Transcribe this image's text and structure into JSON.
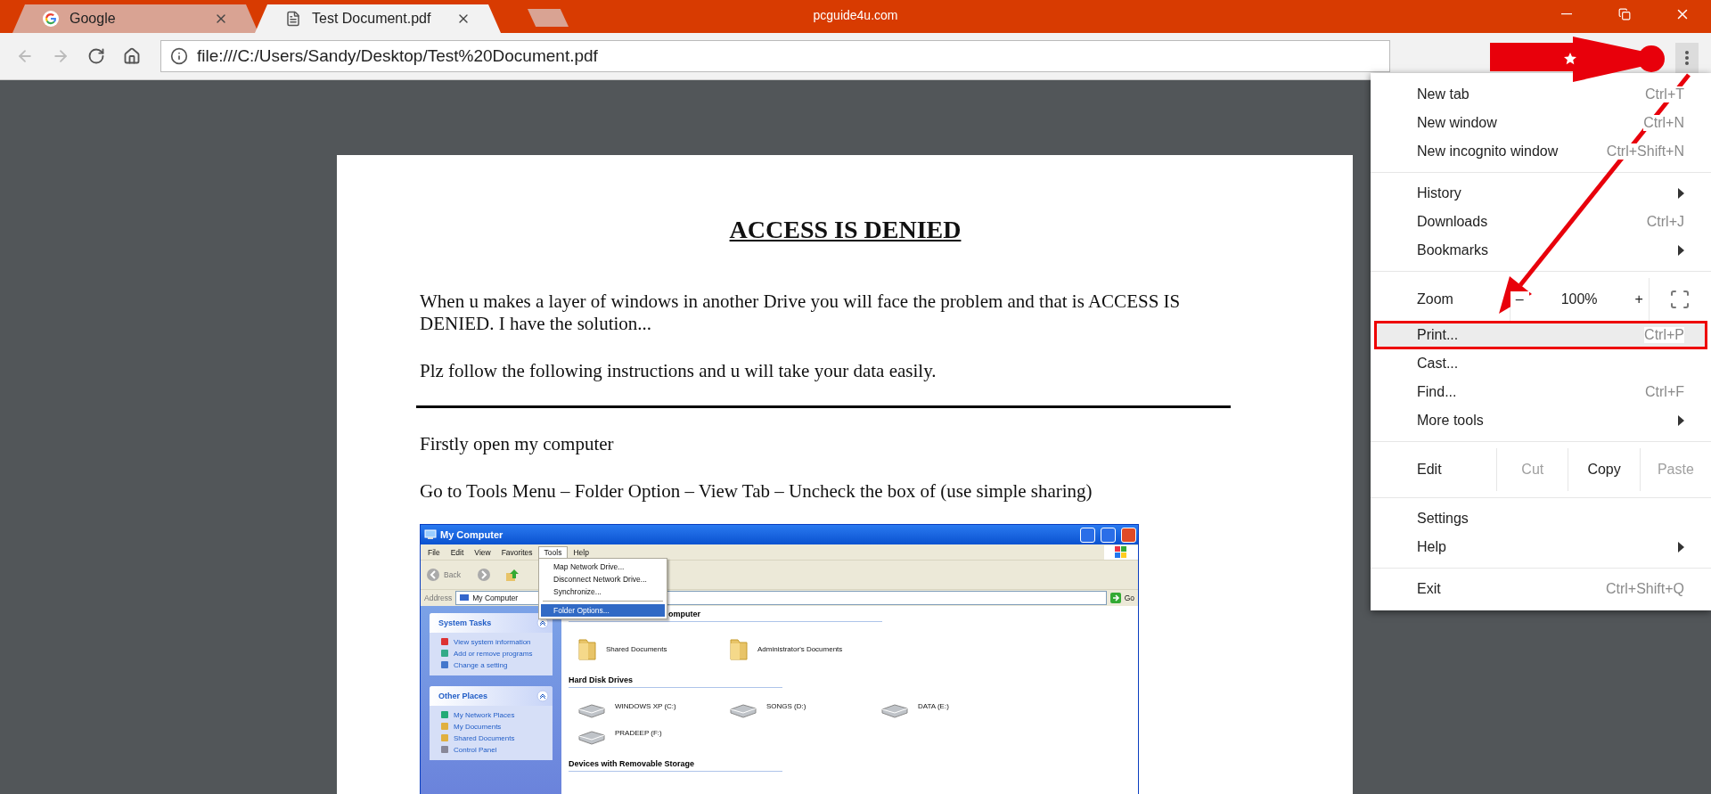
{
  "browser": {
    "window_title": "pcguide4u.com",
    "tabs": [
      {
        "title": "Google",
        "kind": "google",
        "selected": false
      },
      {
        "title": "Test Document.pdf",
        "kind": "document",
        "selected": true
      }
    ],
    "nav": [
      {
        "kind": "back",
        "disabled": true
      },
      {
        "kind": "forward",
        "disabled": true
      },
      {
        "kind": "reload",
        "disabled": false
      },
      {
        "kind": "home",
        "disabled": false
      }
    ],
    "address": "file:///C:/Users/Sandy/Desktop/Test%20Document.pdf"
  },
  "menu": {
    "items": [
      {
        "kind": "item",
        "label": "New tab",
        "shortcut": "Ctrl+T",
        "selected": false
      },
      {
        "kind": "item",
        "label": "New window",
        "shortcut": "Ctrl+N",
        "selected": false
      },
      {
        "kind": "item",
        "label": "New incognito window",
        "shortcut": "Ctrl+Shift+N",
        "selected": false
      },
      {
        "kind": "separator"
      },
      {
        "kind": "submenu",
        "label": "History",
        "selected": false
      },
      {
        "kind": "item",
        "label": "Downloads",
        "shortcut": "Ctrl+J",
        "selected": false
      },
      {
        "kind": "submenu",
        "label": "Bookmarks",
        "selected": false
      },
      {
        "kind": "separator"
      },
      {
        "kind": "zoom",
        "label": "Zoom",
        "minus": "–",
        "value": "100%",
        "plus": "+"
      },
      {
        "kind": "item",
        "label": "Print...",
        "shortcut": "Ctrl+P",
        "selected": true
      },
      {
        "kind": "item",
        "label": "Cast...",
        "selected": false
      },
      {
        "kind": "item",
        "label": "Find...",
        "shortcut": "Ctrl+F",
        "selected": false
      },
      {
        "kind": "submenu",
        "label": "More tools",
        "selected": false
      },
      {
        "kind": "separator"
      },
      {
        "kind": "edit",
        "label": "Edit",
        "actions": [
          {
            "label": "Cut",
            "disabled": true
          },
          {
            "label": "Copy",
            "disabled": false
          },
          {
            "label": "Paste",
            "disabled": true
          }
        ]
      },
      {
        "kind": "separator"
      },
      {
        "kind": "item",
        "label": "Settings",
        "selected": false
      },
      {
        "kind": "submenu",
        "label": "Help",
        "selected": false
      },
      {
        "kind": "separator"
      },
      {
        "kind": "item",
        "label": "Exit",
        "shortcut": "Ctrl+Shift+Q",
        "selected": false
      }
    ]
  },
  "document": {
    "blocks": [
      {
        "kind": "heading",
        "text": "ACCESS IS DENIED"
      },
      {
        "kind": "paragraph",
        "text": "When u makes a layer of windows in another Drive you will face the problem and that is ACCESS IS DENIED. I have the solution..."
      },
      {
        "kind": "paragraph",
        "text": "Plz follow the following instructions and u will take your data easily."
      },
      {
        "kind": "rule"
      },
      {
        "kind": "paragraph",
        "text": "Firstly open my computer"
      },
      {
        "kind": "paragraph",
        "text": "Go to Tools Menu – Folder Option – View Tab – Uncheck the box of (use simple sharing)"
      },
      {
        "kind": "screenshot",
        "window": {
          "title": "My Computer",
          "menu": [
            {
              "label": "File",
              "selected": false
            },
            {
              "label": "Edit",
              "selected": false
            },
            {
              "label": "View",
              "selected": false
            },
            {
              "label": "Favorites",
              "selected": false
            },
            {
              "label": "Tools",
              "selected": true
            },
            {
              "label": "Help",
              "selected": false
            }
          ],
          "dropdown": [
            {
              "kind": "item",
              "label": "Map Network Drive...",
              "selected": false
            },
            {
              "kind": "item",
              "label": "Disconnect Network Drive...",
              "selected": false
            },
            {
              "kind": "item",
              "label": "Synchronize...",
              "selected": false
            },
            {
              "kind": "separator"
            },
            {
              "kind": "item",
              "label": "Folder Options...",
              "selected": true
            }
          ],
          "back": "Back",
          "address_label": "Address",
          "address": "My Computer",
          "go": "Go",
          "panels": [
            {
              "title": "System Tasks",
              "links": [
                {
                  "label": "View system information",
                  "kind": "info"
                },
                {
                  "label": "Add or remove programs",
                  "kind": "programs"
                },
                {
                  "label": "Change a setting",
                  "kind": "setting"
                }
              ]
            },
            {
              "title": "Other Places",
              "links": [
                {
                  "label": "My Network Places",
                  "kind": "network"
                },
                {
                  "label": "My Documents",
                  "kind": "folder"
                },
                {
                  "label": "Shared Documents",
                  "kind": "folder"
                },
                {
                  "label": "Control Panel",
                  "kind": "panel"
                }
              ]
            }
          ],
          "sections": [
            {
              "title": "omputer",
              "items": [
                {
                  "label": "Shared Documents",
                  "kind": "folder"
                },
                {
                  "label": "Administrator's Documents",
                  "kind": "folder"
                }
              ]
            },
            {
              "title": "Hard Disk Drives",
              "items": [
                {
                  "label": "WINDOWS XP (C:)",
                  "kind": "drive"
                },
                {
                  "label": "SONGS (D:)",
                  "kind": "drive"
                },
                {
                  "label": "DATA (E:)",
                  "kind": "drive"
                },
                {
                  "label": "PRADEEP (F:)",
                  "kind": "drive"
                }
              ]
            },
            {
              "title": "Devices with Removable Storage"
            }
          ]
        }
      }
    ]
  }
}
